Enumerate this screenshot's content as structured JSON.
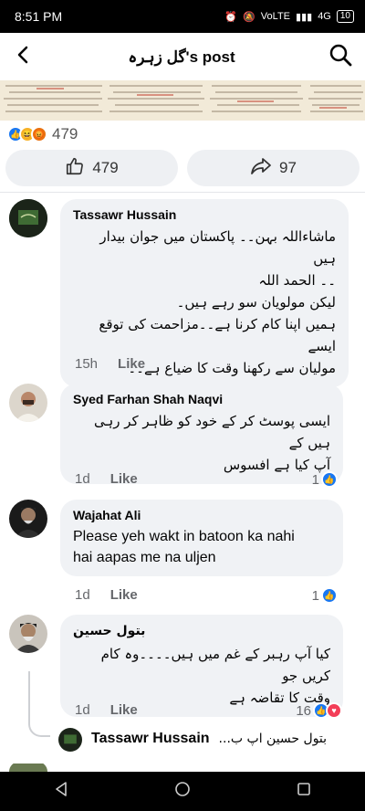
{
  "status": {
    "time": "8:51 PM",
    "network": "VoLTE",
    "signal": "4G",
    "battery": "10"
  },
  "header": {
    "title": "گل زہرہ's post"
  },
  "post": {
    "reaction_total": "479",
    "like_count": "479",
    "share_count": "97"
  },
  "comments": [
    {
      "name": "Tassawr Hussain",
      "lines": [
        "ماشاءاللہ بہن۔۔ پاکستان میں جوان بیدار ہیں",
        "۔۔ الحمد اللہ",
        "لیکن مولویان سو رہے ہیں۔",
        "ہمیں اپنا کام کرنا ہے۔۔مزاحمت کی توقع ایسے",
        "مولیان سے رکھنا وقت کا ضیاع ہے۔۔"
      ],
      "time": "15h",
      "like_label": "Like"
    },
    {
      "name": "Syed Farhan Shah Naqvi",
      "lines": [
        "ایسی پوسٹ کر کے خود کو ظاہر کر رہی ہیں کے",
        "آپ کیا ہے افسوس"
      ],
      "time": "1d",
      "like_label": "Like",
      "reactions": "1"
    },
    {
      "name": "Wajahat Ali",
      "lines": [
        "Please yeh wakt in batoon ka nahi",
        "hai aapas me na uljen"
      ],
      "time": "1d",
      "like_label": "Like",
      "reactions": "1"
    },
    {
      "name": "بتول حسین",
      "lines": [
        "کیا آپ رہبر کے غم میں ہیں۔۔۔۔وہ کام کریں جو",
        "وقت کا تقاضہ ہے"
      ],
      "time": "1d",
      "like_label": "Like",
      "reactions": "16"
    }
  ],
  "reply_preview": {
    "name": "Tassawr Hussain",
    "text": "بتول حسین اپ ب..."
  },
  "icons": {
    "back": "back-arrow-icon",
    "search": "search-icon",
    "like": "thumbs-up-icon",
    "share": "share-arrow-icon"
  },
  "colors": {
    "like_blue": "#1877f2",
    "love_red": "#f33e58",
    "haha_yellow": "#f7b125",
    "angry_orange": "#e9710f"
  }
}
